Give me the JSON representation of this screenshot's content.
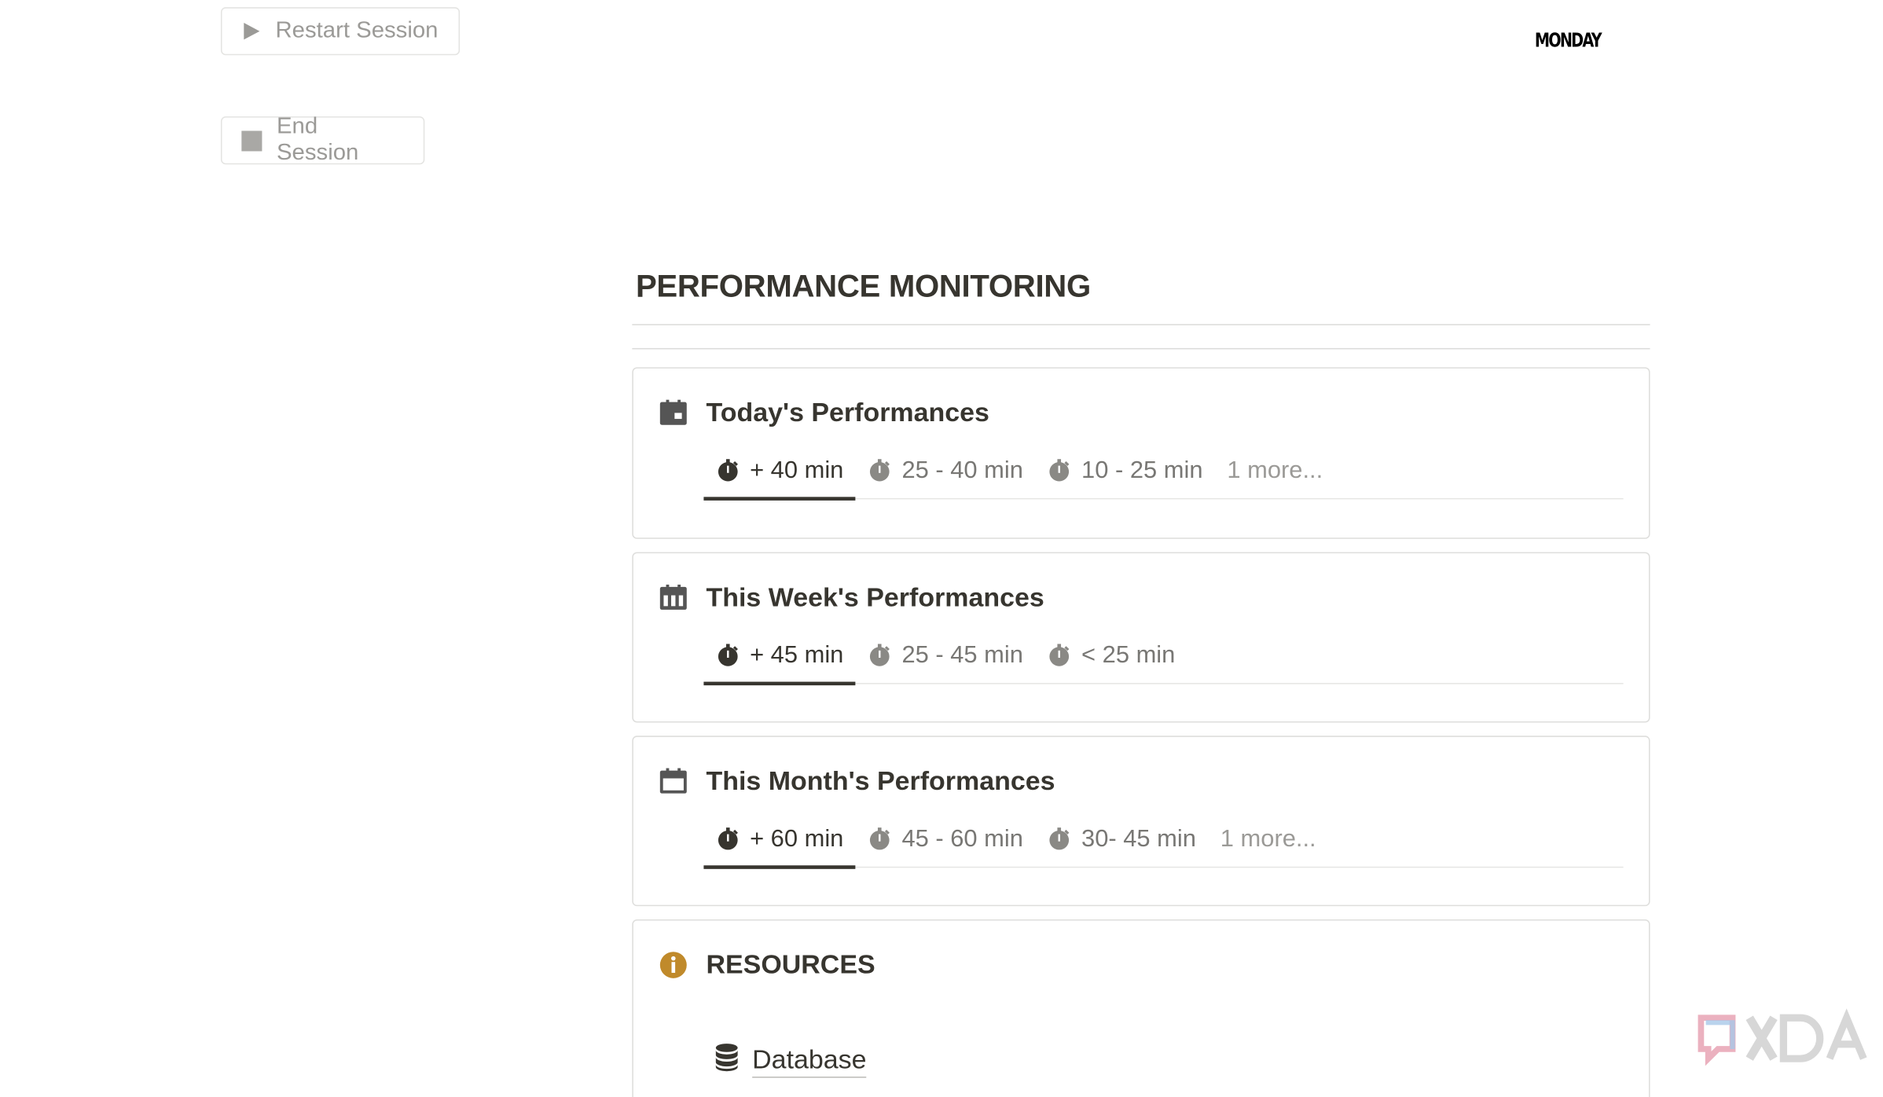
{
  "session_controls": {
    "restart_label": "Restart Session",
    "end_label": "End Session"
  },
  "header": {
    "day": "MONDAY"
  },
  "section": {
    "title": "PERFORMANCE MONITORING"
  },
  "cards": {
    "today": {
      "title": "Today's Performances",
      "icon": "calendar-day-icon",
      "tabs": [
        "+ 40 min",
        "25 - 40 min",
        "10 - 25 min"
      ],
      "more": "1 more..."
    },
    "week": {
      "title": "This Week's Performances",
      "icon": "calendar-week-icon",
      "tabs": [
        "+ 45 min",
        "25 - 45 min",
        "< 25 min"
      ]
    },
    "month": {
      "title": "This Month's Performances",
      "icon": "calendar-month-icon",
      "tabs": [
        "+ 60 min",
        "45 - 60 min",
        "30- 45 min"
      ],
      "more": "1 more..."
    },
    "resources": {
      "title": "RESOURCES",
      "icon": "info-icon",
      "icon_color": "#c08a2b",
      "link_label": "Database",
      "link_icon": "database-icon"
    }
  },
  "watermark": {
    "brand": "XDA"
  }
}
